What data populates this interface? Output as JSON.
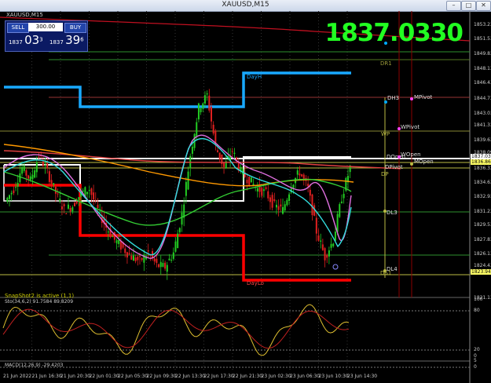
{
  "window": {
    "title": "XAUUSD,M15",
    "min_icon": "minimize-icon",
    "max_icon": "maximize-icon",
    "close_icon": "close-icon"
  },
  "chart": {
    "symbol_label": "XAUUSD,M15",
    "big_price": "1837.0330",
    "snapshot_text": "SnapShot2 is active (1,1)",
    "stoch_label": "Sto(34,6,2) 91.7584 89.8209",
    "macd_label": "MACD(12,26,9) -29.4203",
    "trade_panel": {
      "sell": "SELL",
      "buy": "BUY",
      "lot": "300.00",
      "sell_price_small": "1837",
      "sell_price_big": "03",
      "sell_price_sup": "3",
      "buy_price_small": "1837",
      "buy_price_big": "39",
      "buy_price_sup": "6"
    },
    "levels": {
      "dr1": "DR1",
      "dayh": "DayH",
      "dh3": "DH3",
      "mpivot": "MPivot",
      "wpivot": "WPivot",
      "wp": "WP",
      "wopen": "WOpen",
      "dopen": "DOpen",
      "mopen": "MOpen",
      "dpivot": "DPivot",
      "dp": "DP",
      "dl3": "DL3",
      "dl4": "DL4",
      "daylo": "DayLo",
      "ds1": "DS1"
    },
    "colors": {
      "accent_green": "#22ff22",
      "pivot_cyan": "#00aaff",
      "daylo_red": "#ff0000",
      "magenta": "#ff44ff"
    }
  },
  "chart_data": {
    "type": "line",
    "y_axis_ticks": [
      "1853.238",
      "1851.530",
      "1849.830",
      "1848.130",
      "1846.430",
      "1844.730",
      "1843.030",
      "1841.330",
      "1839.630",
      "1838.090",
      "1836.330",
      "1834.630",
      "1832.930",
      "1831.230",
      "1829.530",
      "1827.830",
      "1826.130",
      "1824.430",
      "1823.946",
      "1821.138"
    ],
    "price_tags": [
      "1837.035",
      "1836.860",
      "1823.946"
    ],
    "x_axis_ticks": [
      "21 Jun 2022",
      "21 Jun 16:30",
      "21 Jun 20:30",
      "22 Jun 01:30",
      "22 Jun 05:30",
      "22 Jun 09:30",
      "22 Jun 13:30",
      "22 Jun 17:30",
      "22 Jun 21:30",
      "23 Jun 02:30",
      "23 Jun 06:30",
      "23 Jun 10:30",
      "23 Jun 14:30"
    ],
    "stoch_ticks": [
      "100",
      "80",
      "20",
      "0"
    ],
    "macd_ticks": [
      "5",
      "0"
    ],
    "ylim": [
      1821.138,
      1853.238
    ],
    "price_series": [
      1832.5,
      1834.0,
      1836.5,
      1835.0,
      1838.0,
      1836.0,
      1833.5,
      1831.5,
      1832.0,
      1833.5,
      1834.0,
      1831.5,
      1829.5,
      1828.0,
      1827.0,
      1826.0,
      1825.5,
      1826.5,
      1825.0,
      1824.8,
      1826.5,
      1831.0,
      1838.0,
      1843.5,
      1845.0,
      1839.0,
      1836.5,
      1838.5,
      1836.0,
      1835.0,
      1834.0,
      1833.5,
      1832.0,
      1831.5,
      1834.5,
      1836.0,
      1834.0,
      1829.0,
      1826.0,
      1828.0,
      1833.0,
      1836.5
    ]
  }
}
